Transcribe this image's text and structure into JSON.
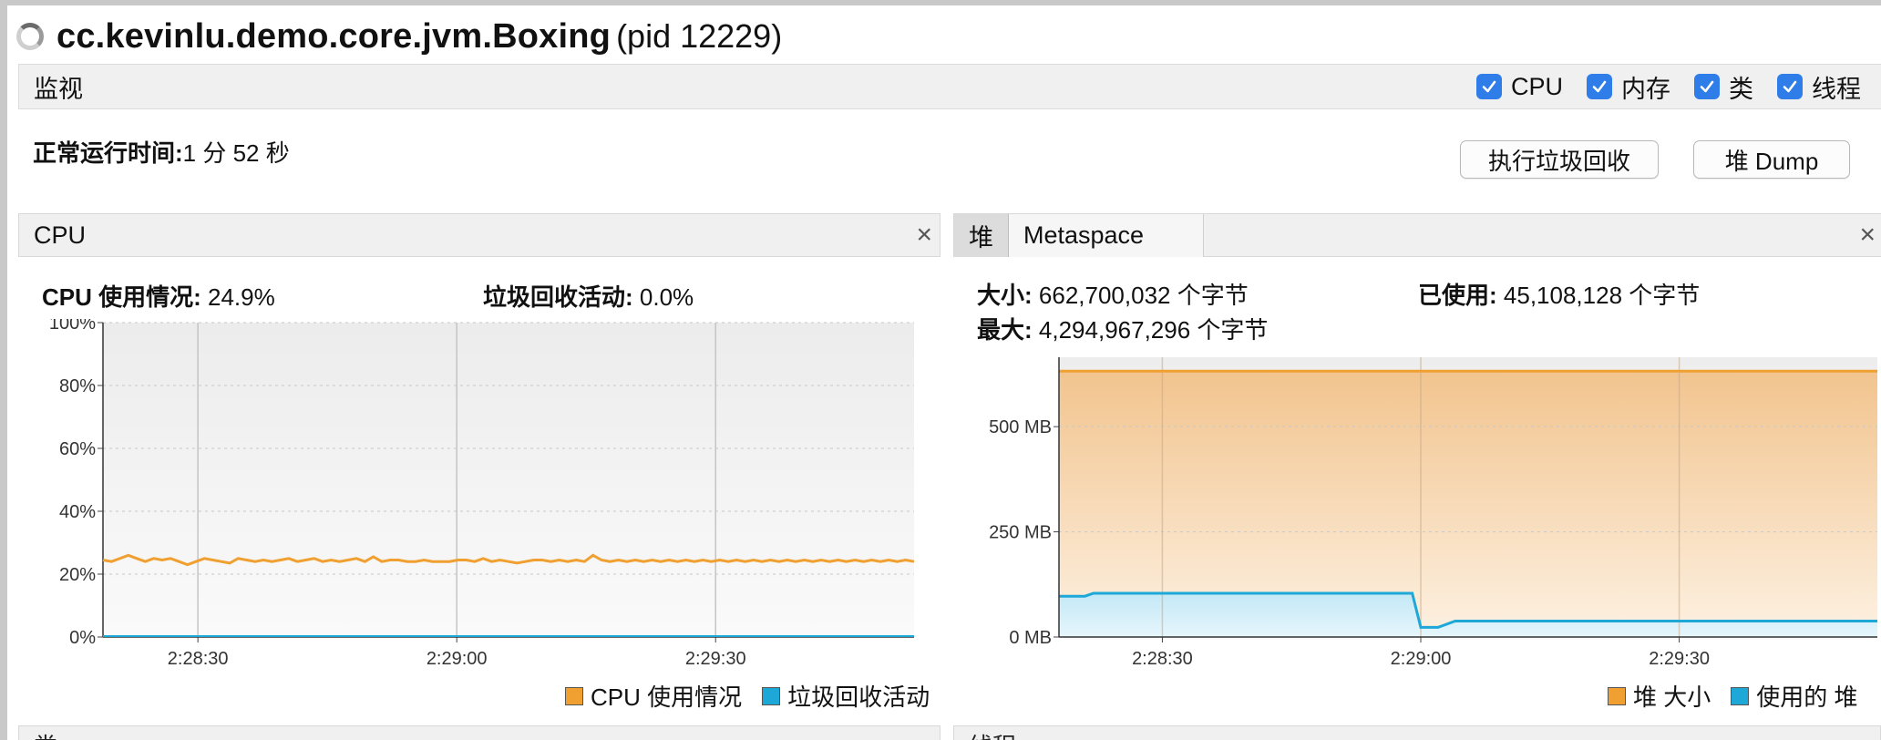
{
  "window": {
    "title": "cc.kevinlu.demo.core.jvm.Boxing",
    "pid": "(pid 12229)"
  },
  "monitor": {
    "label": "监视",
    "toggles": [
      {
        "label": "CPU",
        "checked": true
      },
      {
        "label": "内存",
        "checked": true
      },
      {
        "label": "类",
        "checked": true
      },
      {
        "label": "线程",
        "checked": true
      }
    ],
    "uptime_label": "正常运行时间:",
    "uptime_value": "1 分 52 秒",
    "gc_button": "执行垃圾回收",
    "heapdump_button": "堆 Dump"
  },
  "cpu_panel": {
    "title": "CPU",
    "usage_label": "CPU 使用情况:",
    "usage_value": "24.9%",
    "gc_label": "垃圾回收活动:",
    "gc_value": "0.0%",
    "legend_cpu": "CPU 使用情况",
    "legend_gc": "垃圾回收活动"
  },
  "heap_panel": {
    "tab_heap": "堆",
    "tab_metaspace": "Metaspace",
    "size_label": "大小:",
    "size_value": "662,700,032 个字节",
    "used_label": "已使用:",
    "used_value": "45,108,128 个字节",
    "max_label": "最大:",
    "max_value": "4,294,967,296 个字节",
    "legend_size": "堆 大小",
    "legend_used": "使用的 堆"
  },
  "bottom_panels": {
    "left_label": "类",
    "right_label": "线程"
  },
  "colors": {
    "orange": "#f0a030",
    "blue": "#1ea8d8",
    "accent": "#2e7de8"
  },
  "chart_data": [
    {
      "type": "line",
      "title": "CPU",
      "x_ticks": [
        "2:28:30",
        "2:29:00",
        "2:29:30"
      ],
      "y_ticks": [
        "0%",
        "20%",
        "40%",
        "60%",
        "80%",
        "100%"
      ],
      "ylim": [
        0,
        100
      ],
      "x_seconds_range": [
        -11,
        83
      ],
      "grid": true,
      "legend_position": "bottom-right",
      "series": [
        {
          "name": "CPU 使用情况",
          "color": "#f0a030",
          "x": [
            -11,
            -9,
            -8,
            -6,
            -4,
            -3,
            -1,
            0,
            1,
            3,
            4,
            6,
            8,
            9,
            10,
            12,
            13,
            14,
            16,
            17,
            19,
            20,
            22,
            23,
            25,
            26,
            28,
            30,
            32,
            34,
            36,
            38,
            40,
            42,
            44,
            46,
            48,
            50,
            52,
            54,
            56,
            58,
            60,
            62,
            63,
            65,
            67,
            68,
            70,
            72,
            74,
            76,
            78,
            80,
            82,
            84,
            86,
            88,
            90,
            92,
            94,
            96,
            98,
            100,
            102,
            104,
            106,
            108,
            110,
            112,
            114,
            116,
            118,
            120,
            122,
            124,
            126,
            128,
            130,
            132,
            134,
            136,
            138,
            140,
            142,
            144,
            146,
            148,
            150,
            152,
            154,
            156,
            158,
            160,
            162,
            164,
            166
          ],
          "y": [
            24.5,
            24,
            25,
            26,
            25,
            24,
            25,
            24.5,
            25,
            24,
            23,
            24,
            25,
            24.5,
            24,
            23.5,
            25,
            24.5,
            24,
            24.5,
            24,
            24.5,
            25,
            24,
            24.5,
            25,
            24,
            24.5,
            24,
            24.5,
            25,
            24,
            25.5,
            24,
            24.5,
            24.5,
            24,
            24,
            24.5,
            24,
            24,
            24,
            24.5,
            24.5,
            24,
            25,
            24,
            24.5,
            24,
            23.5,
            24,
            24.5,
            24.5,
            24,
            24.5,
            24,
            24.5,
            24,
            26,
            24.5,
            24,
            24.5,
            24,
            24.5,
            24,
            24.5,
            24,
            24.5,
            24,
            24.5,
            24,
            24.5,
            24,
            24.5,
            24,
            24.5,
            24,
            24.5,
            24,
            24.5,
            24,
            24.5,
            24,
            24.5,
            24,
            24.5,
            24,
            24.5,
            24,
            24.5,
            24,
            24.5,
            24,
            24.5,
            24,
            24.5,
            24
          ]
        },
        {
          "name": "垃圾回收活动",
          "color": "#1ea8d8",
          "x": [
            -11,
            83
          ],
          "y": [
            0,
            0
          ]
        }
      ]
    },
    {
      "type": "area",
      "title": "堆",
      "x_ticks": [
        "2:28:30",
        "2:29:00",
        "2:29:30"
      ],
      "y_ticks": [
        "0 MB",
        "250 MB",
        "500 MB"
      ],
      "ylim": [
        0,
        665
      ],
      "x_seconds_range": [
        -12,
        83
      ],
      "grid": true,
      "legend_position": "bottom-right",
      "series": [
        {
          "name": "堆 大小",
          "color": "#f0a030",
          "x": [
            -12,
            83
          ],
          "y": [
            632,
            632
          ]
        },
        {
          "name": "使用的 堆",
          "color": "#1ea8d8",
          "x": [
            -12,
            -9,
            -8,
            0,
            10,
            20,
            29,
            30,
            31,
            32,
            34,
            40,
            50,
            60,
            70,
            83
          ],
          "y": [
            97,
            97,
            104,
            104,
            104,
            104,
            104,
            23,
            23,
            23,
            38,
            38,
            38,
            38,
            38,
            38
          ]
        }
      ]
    }
  ]
}
